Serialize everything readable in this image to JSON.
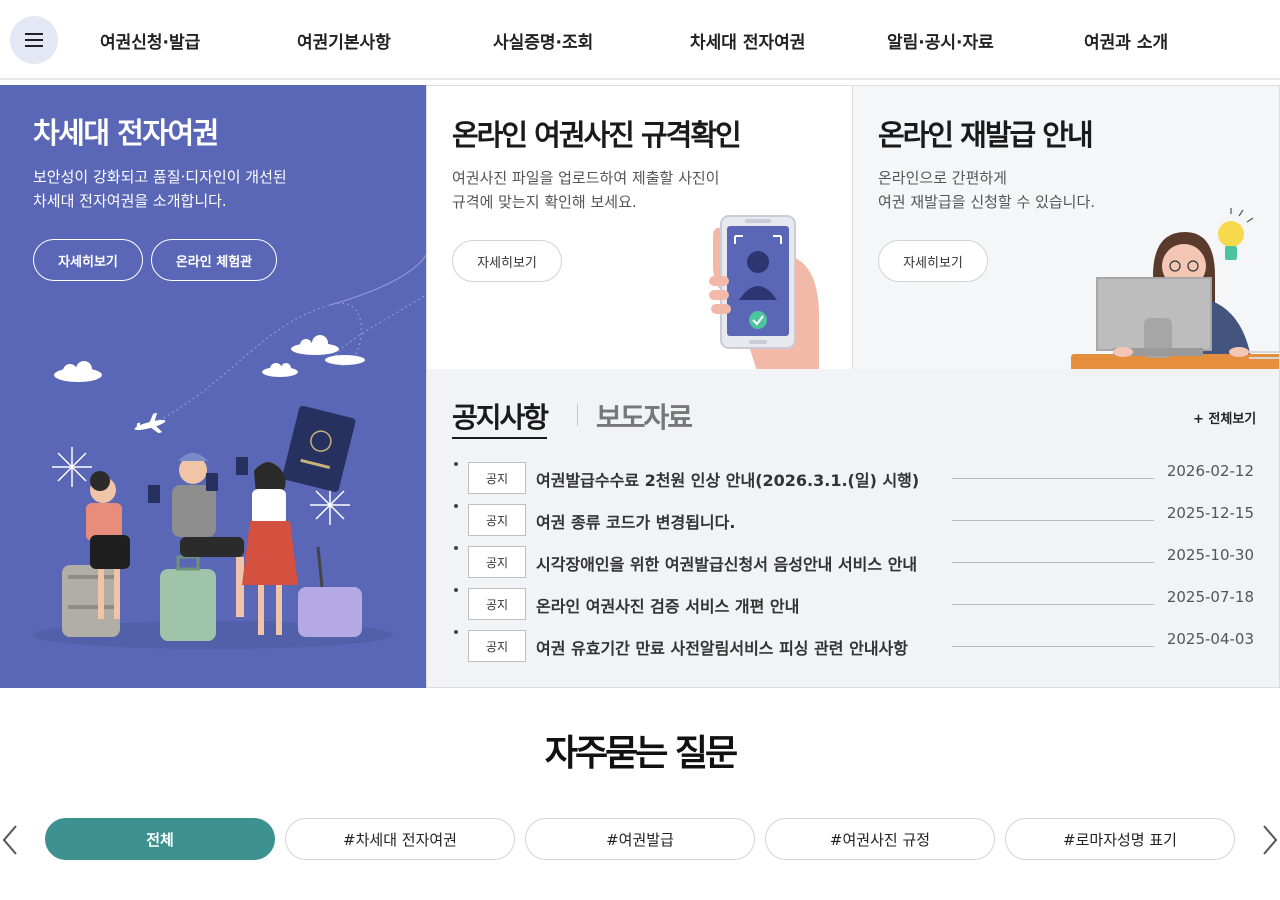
{
  "header": {
    "menu_icon": "hamburger-menu-icon",
    "nav": [
      {
        "label": "여권신청·발급"
      },
      {
        "label": "여권기본사항"
      },
      {
        "label": "사실증명·조회"
      },
      {
        "label": "차세대 전자여권"
      },
      {
        "label": "알림·공시·자료"
      },
      {
        "label": "여권과 소개"
      }
    ]
  },
  "hero": {
    "title": "차세대 전자여권",
    "desc_line1": "보안성이 강화되고 품질·디자인이 개선된",
    "desc_line2": "차세대 전자여권을 소개합니다.",
    "buttons": [
      {
        "label": "자세히보기"
      },
      {
        "label": "온라인 체험관"
      }
    ],
    "bg_color": "#5a66b6"
  },
  "cards": [
    {
      "title": "온라인 여권사진 규격확인",
      "desc_line1": "여권사진 파일을 업로드하여 제출할 사진이",
      "desc_line2": "규격에 맞는지 확인해 보세요.",
      "button": "자세히보기"
    },
    {
      "title": "온라인 재발급 안내",
      "desc_line1": "온라인으로 간편하게",
      "desc_line2": "여권 재발급을 신청할 수 있습니다.",
      "button": "자세히보기"
    }
  ],
  "board": {
    "tabs": [
      {
        "label": "공지사항",
        "active": true
      },
      {
        "label": "보도자료",
        "active": false
      }
    ],
    "view_all": "+ 전체보기",
    "notices": [
      {
        "badge": "공지",
        "title": "여권발급수수료 2천원 인상 안내(2026.3.1.(일) 시행)",
        "date": "2026-02-12"
      },
      {
        "badge": "공지",
        "title": "여권 종류 코드가 변경됩니다.",
        "date": "2025-12-15"
      },
      {
        "badge": "공지",
        "title": "시각장애인을 위한 여권발급신청서 음성안내 서비스 안내",
        "date": "2025-10-30"
      },
      {
        "badge": "공지",
        "title": "온라인 여권사진 검증 서비스 개편 안내",
        "date": "2025-07-18"
      },
      {
        "badge": "공지",
        "title": "여권 유효기간 만료 사전알림서비스 피싱 관련 안내사항",
        "date": "2025-04-03"
      }
    ]
  },
  "faq": {
    "title": "자주묻는 질문",
    "tabs": [
      {
        "label": "전체",
        "active": true
      },
      {
        "label": "#차세대 전자여권",
        "active": false
      },
      {
        "label": "#여권발급",
        "active": false
      },
      {
        "label": "#여권사진 규정",
        "active": false
      },
      {
        "label": "#로마자성명 표기",
        "active": false
      }
    ],
    "prev_icon": "chevron-left-icon",
    "next_icon": "chevron-right-icon",
    "accent_color": "#3e9191"
  }
}
